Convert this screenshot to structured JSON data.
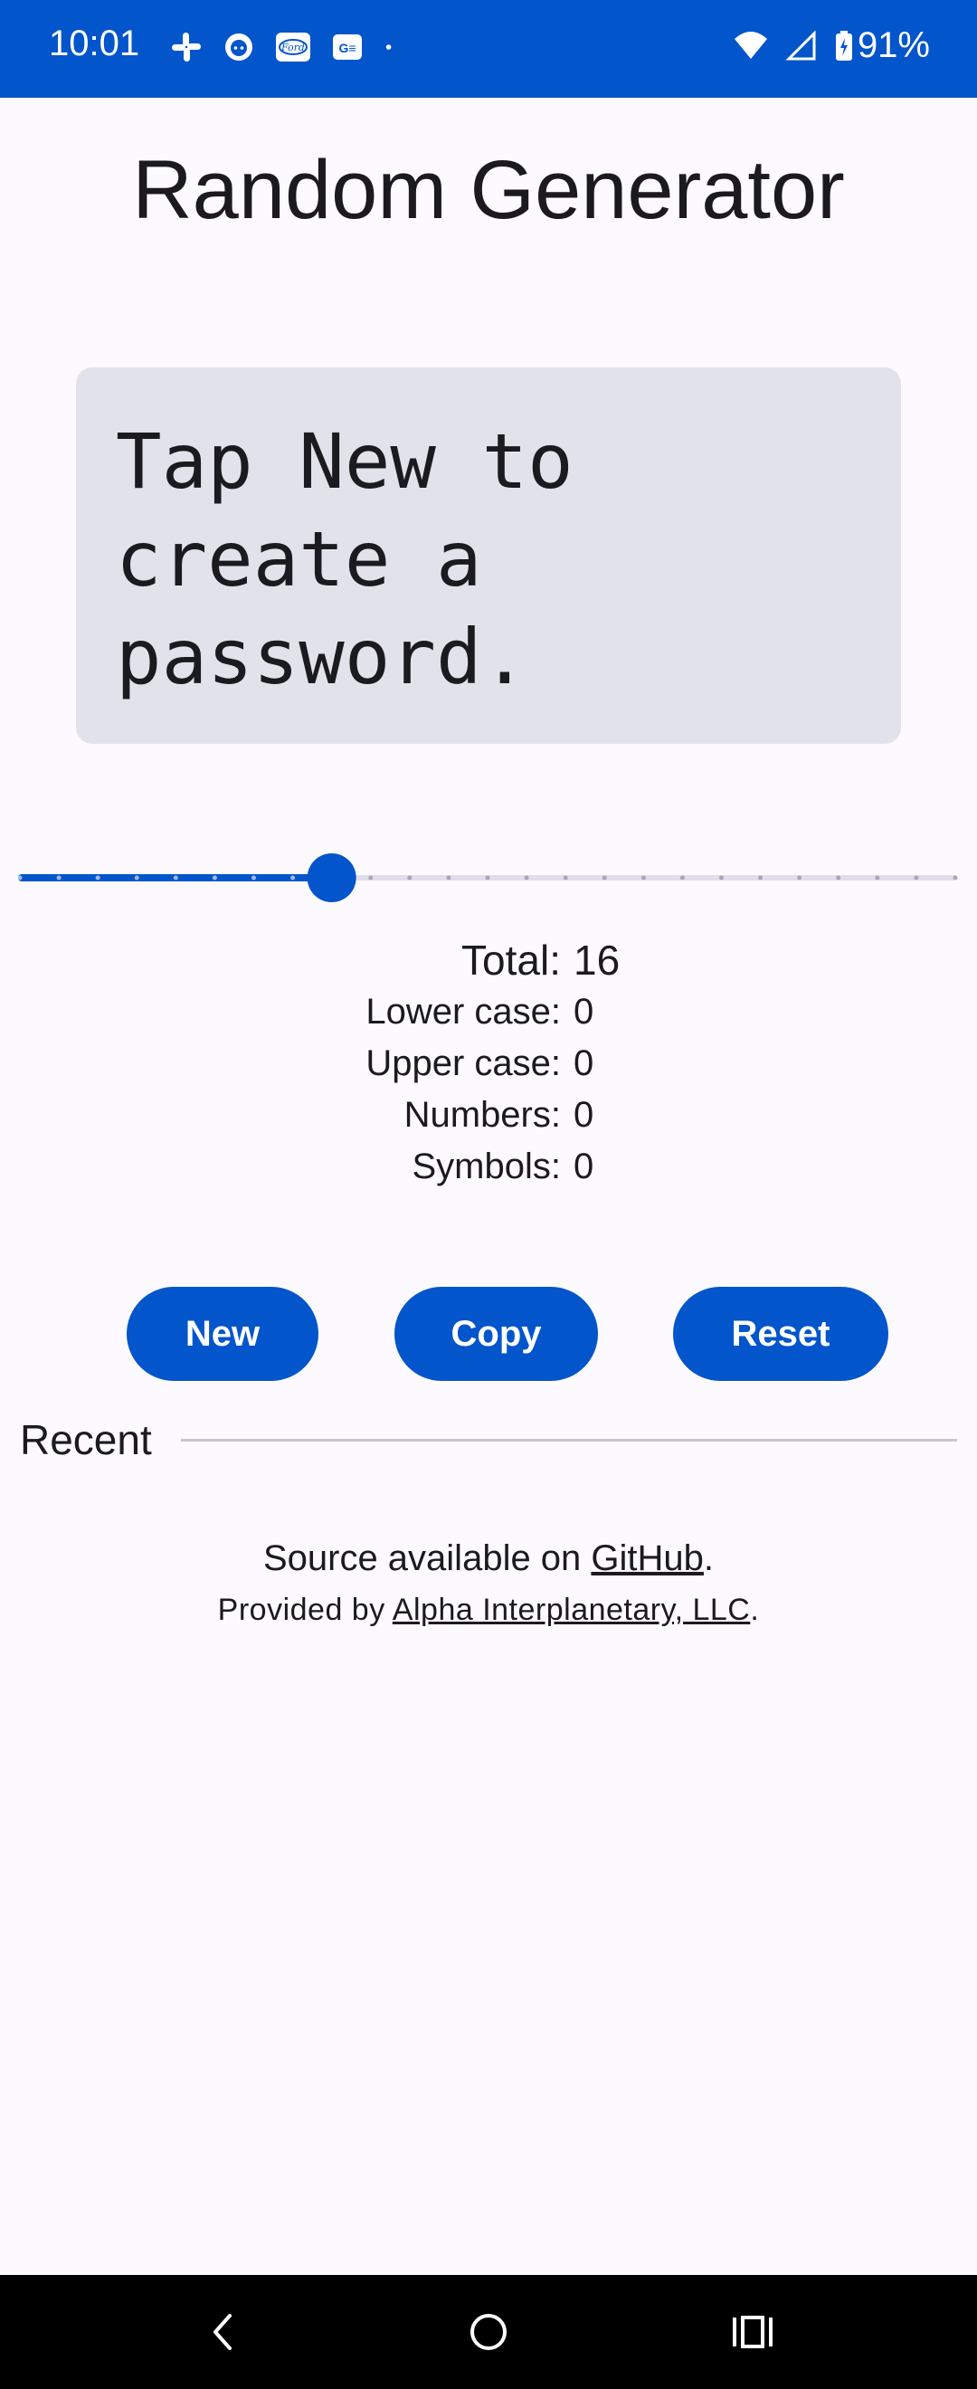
{
  "status_bar": {
    "time": "10:01",
    "battery": "91%",
    "left_icons": [
      "slack-icon",
      "github-icon",
      "ford-icon",
      "news-icon",
      "dot-icon"
    ],
    "right_icons": [
      "wifi-icon",
      "signal-icon",
      "battery-charging-icon"
    ],
    "background": "#0355CB"
  },
  "app": {
    "title": "Random Generator",
    "password_placeholder": "Tap New to\ncreate a\npassword."
  },
  "slider": {
    "value": 16,
    "min": 8,
    "max": 32,
    "active_color": "#0355CB",
    "inactive_color": "#E0DEEA"
  },
  "stats": {
    "total_label": "Total:",
    "total_value": "16",
    "lower_label": "Lower case:",
    "lower_value": "0",
    "upper_label": "Upper case:",
    "upper_value": "0",
    "numbers_label": "Numbers:",
    "numbers_value": "0",
    "symbols_label": "Symbols:",
    "symbols_value": "0"
  },
  "buttons": {
    "new_label": "New",
    "copy_label": "Copy",
    "reset_label": "Reset"
  },
  "recent": {
    "label": "Recent"
  },
  "footer": {
    "source_prefix": "Source available on ",
    "source_link": "GitHub",
    "source_suffix": ".",
    "provided_prefix": "Provided by ",
    "provided_link": "Alpha Interplanetary, LLC",
    "provided_suffix": "."
  },
  "nav_bar": {
    "icons": [
      "back-icon",
      "home-icon",
      "recents-icon"
    ]
  }
}
